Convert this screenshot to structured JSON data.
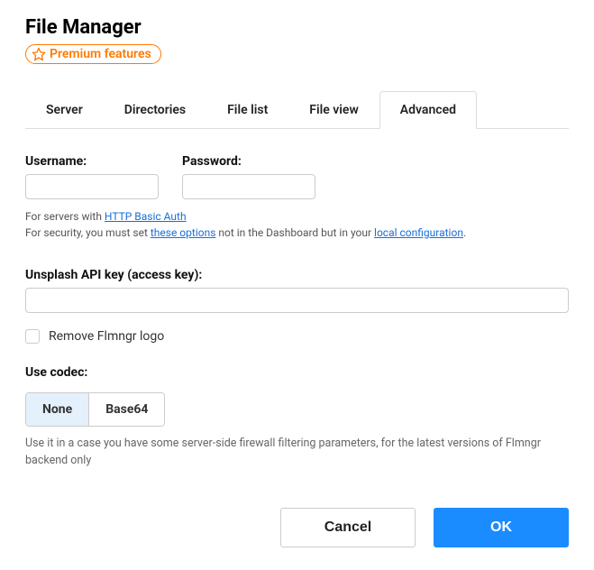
{
  "header": {
    "title": "File Manager",
    "premium_label": "Premium features"
  },
  "tabs": {
    "t0": "Server",
    "t1": "Directories",
    "t2": "File list",
    "t3": "File view",
    "t4": "Advanced"
  },
  "form": {
    "username_label": "Username:",
    "password_label": "Password:",
    "help_prefix": "For servers with ",
    "help_link1": "HTTP Basic Auth",
    "help2_prefix": "For security, you must set ",
    "help2_link": "these options",
    "help2_mid": " not in the Dashboard but in your ",
    "help2_link2": "local configuration",
    "help2_suffix": ".",
    "unsplash_label": "Unsplash API key (access key):",
    "remove_logo_label": "Remove Flmngr logo",
    "codec_label": "Use codec:",
    "codec_none": "None",
    "codec_base64": "Base64",
    "codec_help": "Use it in a case you have some server-side firewall filtering parameters, for the latest versions of Flmngr backend only"
  },
  "buttons": {
    "cancel": "Cancel",
    "ok": "OK"
  }
}
